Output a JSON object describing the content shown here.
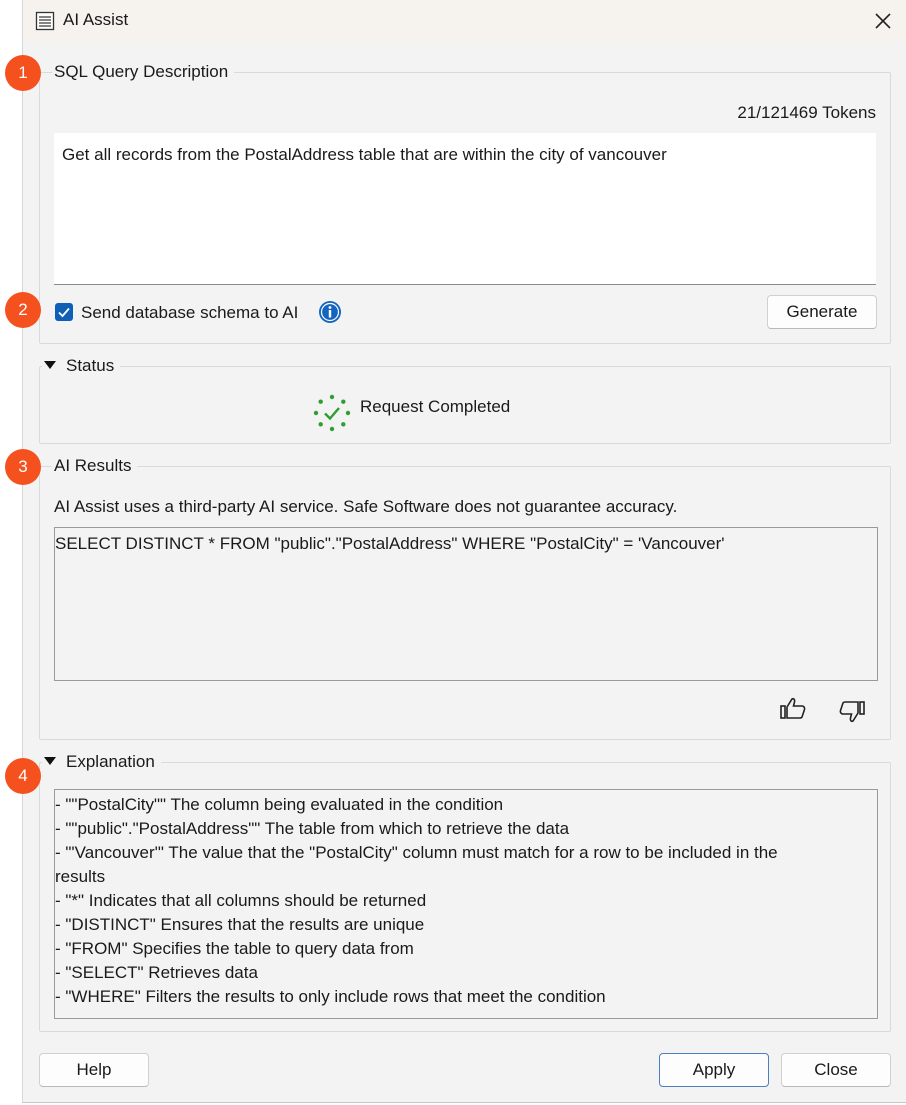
{
  "window": {
    "title": "AI Assist"
  },
  "markers": [
    "1",
    "2",
    "3",
    "4"
  ],
  "query_description": {
    "label": "SQL Query Description",
    "tokens": "21/121469 Tokens",
    "text": "Get all records from the PostalAddress table that are within the city of vancouver",
    "send_schema_label": "Send database schema to AI",
    "send_schema_checked": true,
    "generate_label": "Generate"
  },
  "status": {
    "label": "Status",
    "message": "Request Completed"
  },
  "results": {
    "label": "AI Results",
    "disclaimer": "AI Assist uses a third-party AI service. Safe Software does not guarantee accuracy.",
    "sql": "SELECT DISTINCT * FROM \"public\".\"PostalAddress\" WHERE \"PostalCity\" = 'Vancouver'"
  },
  "explanation": {
    "label": "Explanation",
    "lines": [
      "- \"\"PostalCity\"\" The column being evaluated in the condition",
      "- \"\"public\".\"PostalAddress\"\" The table from which to retrieve the data",
      "- \"'Vancouver'\" The value that the \"PostalCity\" column must match for a row to be included in the",
      "results",
      "- \"*\" Indicates that all columns should be returned",
      "- \"DISTINCT\" Ensures that the results are unique",
      "- \"FROM\" Specifies the table to query data from",
      "- \"SELECT\" Retrieves data",
      "- \"WHERE\" Filters the results to only include rows that meet the condition"
    ]
  },
  "footer": {
    "help_label": "Help",
    "apply_label": "Apply",
    "close_label": "Close"
  },
  "colors": {
    "marker": "#f4511e",
    "checkbox": "#0f5fb6",
    "info": "#1565c0",
    "success": "#2e9e2e"
  }
}
